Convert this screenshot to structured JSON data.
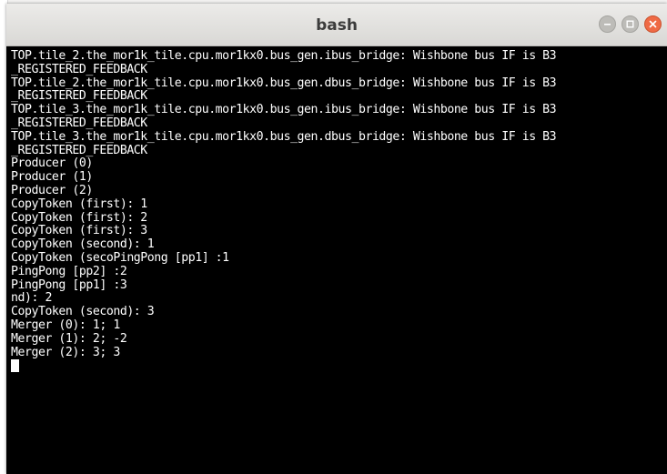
{
  "window": {
    "title": "bash"
  },
  "terminal": {
    "lines": [
      "TOP.tile_2.the_mor1k_tile.cpu.mor1kx0.bus_gen.ibus_bridge: Wishbone bus IF is B3",
      "_REGISTERED_FEEDBACK",
      "TOP.tile_2.the_mor1k_tile.cpu.mor1kx0.bus_gen.dbus_bridge: Wishbone bus IF is B3",
      "_REGISTERED_FEEDBACK",
      "TOP.tile_3.the_mor1k_tile.cpu.mor1kx0.bus_gen.ibus_bridge: Wishbone bus IF is B3",
      "_REGISTERED_FEEDBACK",
      "TOP.tile_3.the_mor1k_tile.cpu.mor1kx0.bus_gen.dbus_bridge: Wishbone bus IF is B3",
      "_REGISTERED_FEEDBACK",
      "Producer (0)",
      "Producer (1)",
      "Producer (2)",
      "CopyToken (first): 1",
      "CopyToken (first): 2",
      "CopyToken (first): 3",
      "CopyToken (second): 1",
      "CopyToken (secoPingPong [pp1] :1",
      "PingPong [pp2] :2",
      "PingPong [pp1] :3",
      "nd): 2",
      "CopyToken (second): 3",
      "Merger (0): 1; 1",
      "Merger (1): 2; -2",
      "Merger (2): 3; 3"
    ]
  }
}
